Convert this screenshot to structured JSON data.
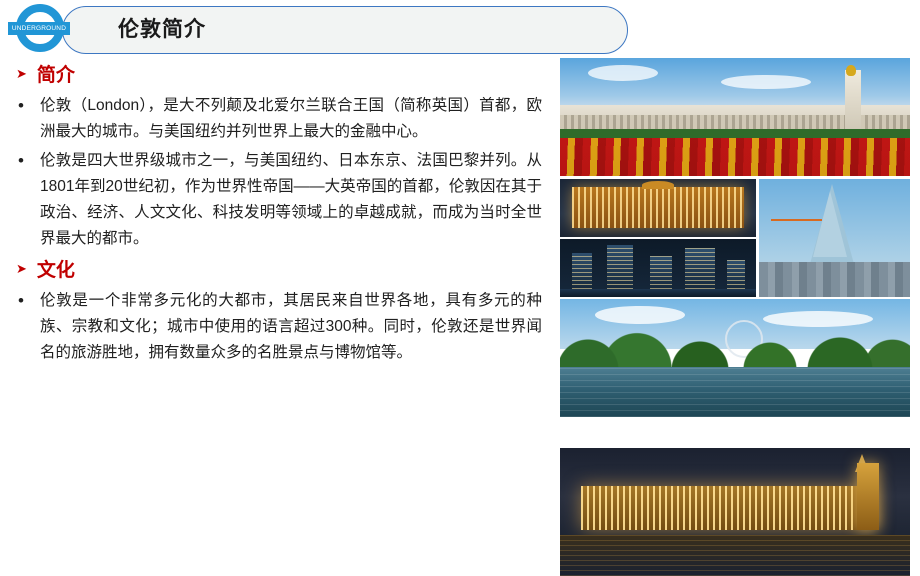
{
  "header": {
    "title": "伦敦简介",
    "logo_text": "UNDERGROUND",
    "logo_color": "#2196d6",
    "border_color": "#3d77c2",
    "bar_bg": "#f2f4f3"
  },
  "accent_color": "#c00000",
  "body_color": "#202020",
  "sections": [
    {
      "icon": "arrow-right-icon",
      "title": "简介",
      "bullets": [
        {
          "marker": "•",
          "text": "伦敦（London），是大不列颠及北爱尔兰联合王国（简称英国）首都，欧洲最大的城市。与美国纽约并列世界上最大的金融中心。"
        },
        {
          "marker": "•",
          "text": "伦敦是四大世界级城市之一，与美国纽约、日本东京、法国巴黎并列。从1801年到20世纪初，作为世界性帝国——大英帝国的首都，伦敦因在其于政治、经济、人文文化、科技发明等领域上的卓越成就，而成为当时全世界最大的都市。"
        }
      ]
    },
    {
      "icon": "arrow-right-icon",
      "title": "文化",
      "bullets": [
        {
          "marker": "•",
          "text": "伦敦是一个非常多元化的大都市，其居民来自世界各地，具有多元的种族、宗教和文化；城市中使用的语言超过300种。同时，伦敦还是世界闻名的旅游胜地，拥有数量众多的名胜景点与博物馆等。"
        }
      ]
    }
  ],
  "photos": [
    {
      "name": "buckingham-palace-photo"
    },
    {
      "name": "harrods-night-photo"
    },
    {
      "name": "canary-wharf-photo"
    },
    {
      "name": "the-shard-photo"
    },
    {
      "name": "hyde-park-lake-photo"
    },
    {
      "name": "westminster-night-photo"
    }
  ]
}
